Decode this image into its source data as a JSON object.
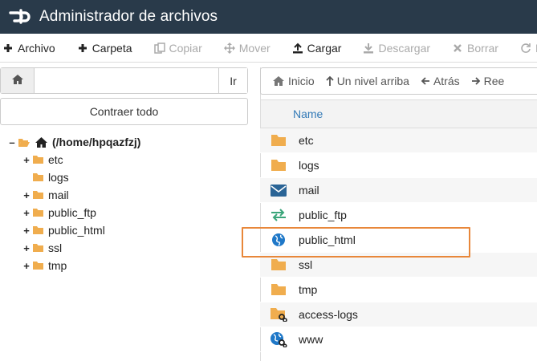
{
  "app": {
    "title": "Administrador de archivos",
    "logo": "cpanel-logo"
  },
  "toolbar": {
    "buttons": [
      {
        "label": "Archivo",
        "icon": "plus-icon",
        "enabled": true
      },
      {
        "label": "Carpeta",
        "icon": "plus-icon",
        "enabled": true
      },
      {
        "label": "Copiar",
        "icon": "copy-icon",
        "enabled": false
      },
      {
        "label": "Mover",
        "icon": "move-icon",
        "enabled": false
      },
      {
        "label": "Cargar",
        "icon": "upload-icon",
        "enabled": true
      },
      {
        "label": "Descargar",
        "icon": "download-icon",
        "enabled": false
      },
      {
        "label": "Borrar",
        "icon": "delete-icon",
        "enabled": false
      },
      {
        "label": "Re",
        "icon": "restore-icon",
        "enabled": false
      }
    ]
  },
  "path_bar": {
    "value": "",
    "go_label": "Ir"
  },
  "collapse_all_label": "Contraer todo",
  "tree": {
    "root_label": "(/home/hpqazfzj)",
    "root_toggle": "–",
    "children": [
      {
        "label": "etc",
        "toggle": "+"
      },
      {
        "label": "logs",
        "toggle": ""
      },
      {
        "label": "mail",
        "toggle": "+"
      },
      {
        "label": "public_ftp",
        "toggle": "+"
      },
      {
        "label": "public_html",
        "toggle": "+"
      },
      {
        "label": "ssl",
        "toggle": "+"
      },
      {
        "label": "tmp",
        "toggle": "+"
      }
    ]
  },
  "nav": {
    "home_label": "Inicio",
    "up_label": "Un nivel arriba",
    "back_label": "Atrás",
    "reload_label": "Ree"
  },
  "list": {
    "header_name": "Name",
    "rows": [
      {
        "name": "etc",
        "icon": "folder-icon"
      },
      {
        "name": "logs",
        "icon": "folder-icon"
      },
      {
        "name": "mail",
        "icon": "mail-envelope-icon"
      },
      {
        "name": "public_ftp",
        "icon": "transfer-arrows-icon"
      },
      {
        "name": "public_html",
        "icon": "globe-icon"
      },
      {
        "name": "ssl",
        "icon": "folder-icon"
      },
      {
        "name": "tmp",
        "icon": "folder-icon"
      },
      {
        "name": "access-logs",
        "icon": "folder-link-icon"
      },
      {
        "name": "www",
        "icon": "globe-link-icon"
      }
    ],
    "highlighted_row": "public_html"
  },
  "colors": {
    "titlebar": "#293a4a",
    "folder": "#f0ad4e",
    "highlight": "#e8873a",
    "link": "#337ab7",
    "mail": "#2a6496",
    "ftp": "#3aa57a",
    "globe": "#1f78c8"
  }
}
